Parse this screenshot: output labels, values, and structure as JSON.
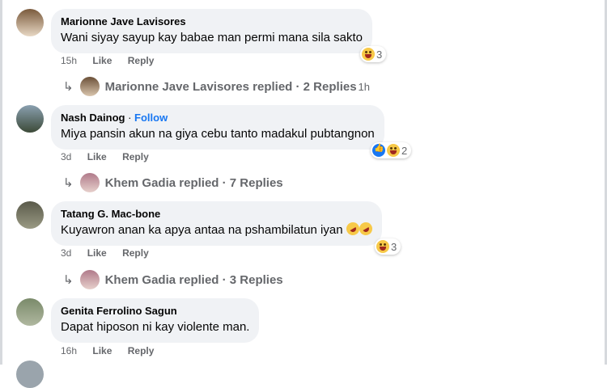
{
  "comments": [
    {
      "author": "Marionne Jave Lavisores",
      "text": "Wani siyay sayup kay babae man permi mana sila sakto",
      "time": "15h",
      "like": "Like",
      "reply": "Reply",
      "reaction_count": "3",
      "reactions": [
        "haha-icon"
      ]
    },
    {
      "author": "Nash Dainog",
      "separator": " · ",
      "follow": "Follow",
      "text": "Miya pansin akun na giya cebu tanto madakul pubtangnon",
      "time": "3d",
      "like": "Like",
      "reply": "Reply",
      "reaction_count": "2",
      "reactions": [
        "like-icon",
        "haha-icon"
      ]
    },
    {
      "author": "Tatang G. Mac-bone",
      "text": "Kuyawron anan ka apya antaa na pshambilatun iyan",
      "time": "3d",
      "like": "Like",
      "reply": "Reply",
      "reaction_count": "3",
      "reactions": [
        "haha-icon"
      ]
    },
    {
      "author": "Genita Ferrolino Sagun",
      "text": "Dapat hiposon ni kay violente man.",
      "time": "16h",
      "like": "Like",
      "reply": "Reply"
    }
  ],
  "reply_threads": [
    {
      "label": "Marionne Jave Lavisores replied · 2 Replies",
      "time": "1h"
    },
    {
      "label": "Khem Gadia replied · 7 Replies"
    },
    {
      "label": "Khem Gadia replied · 3 Replies"
    }
  ],
  "colors": {
    "bubble": "#f0f2f5",
    "link": "#1877f2",
    "meta": "#65676b"
  }
}
